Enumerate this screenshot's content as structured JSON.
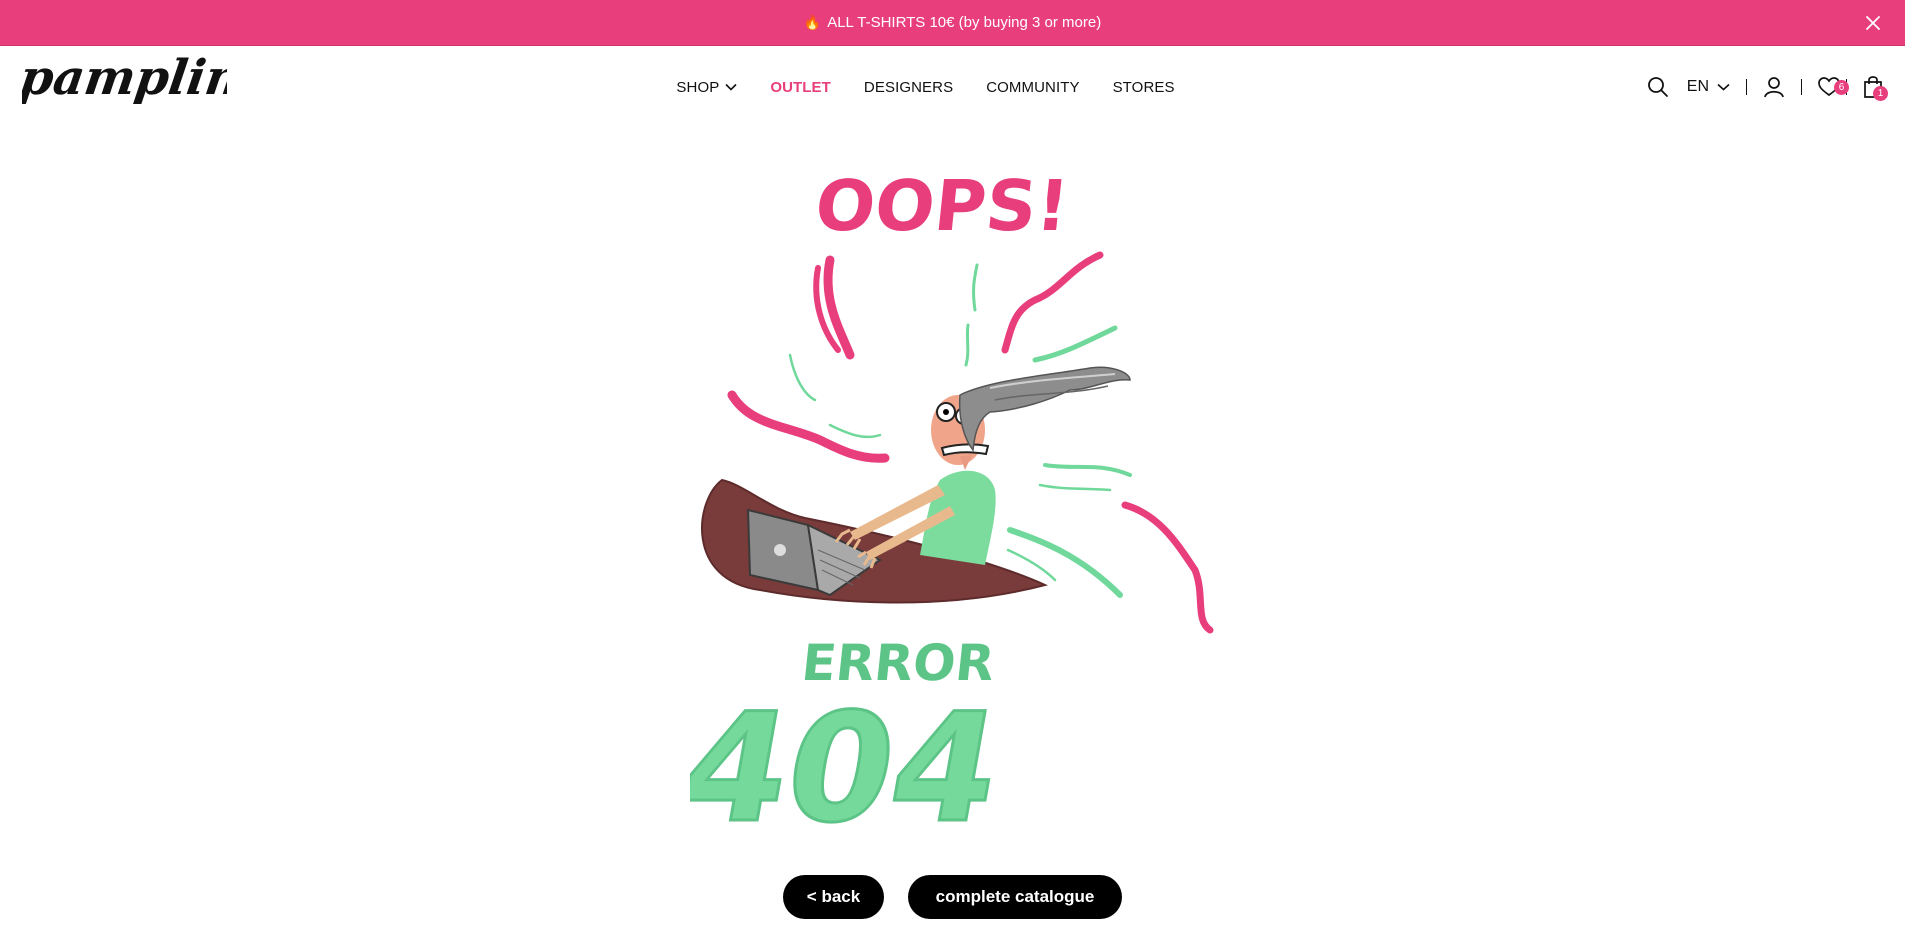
{
  "promo": {
    "icon": "flame-icon",
    "text": "ALL T-SHIRTS 10€ (by buying 3 or more)",
    "close_icon": "close-icon"
  },
  "header": {
    "logo_text": "pampling",
    "nav": [
      {
        "label": "SHOP",
        "has_dropdown": true,
        "active": false
      },
      {
        "label": "OUTLET",
        "has_dropdown": false,
        "active": true
      },
      {
        "label": "DESIGNERS",
        "has_dropdown": false,
        "active": false
      },
      {
        "label": "COMMUNITY",
        "has_dropdown": false,
        "active": false
      },
      {
        "label": "STORES",
        "has_dropdown": false,
        "active": false
      }
    ],
    "language": "EN",
    "wishlist_count": "6",
    "cart_count": "1",
    "icons": [
      "search-icon",
      "chevron-down-icon",
      "user-icon",
      "heart-icon",
      "shopping-bag-icon"
    ]
  },
  "error": {
    "headline": "OOPS!",
    "label": "ERROR",
    "code": "404"
  },
  "actions": {
    "back_label": "< back",
    "catalogue_label": "complete catalogue"
  },
  "colors": {
    "accent": "#e83e7c",
    "green": "#6fd89a",
    "desk": "#7a3b3b",
    "button": "#000000"
  }
}
